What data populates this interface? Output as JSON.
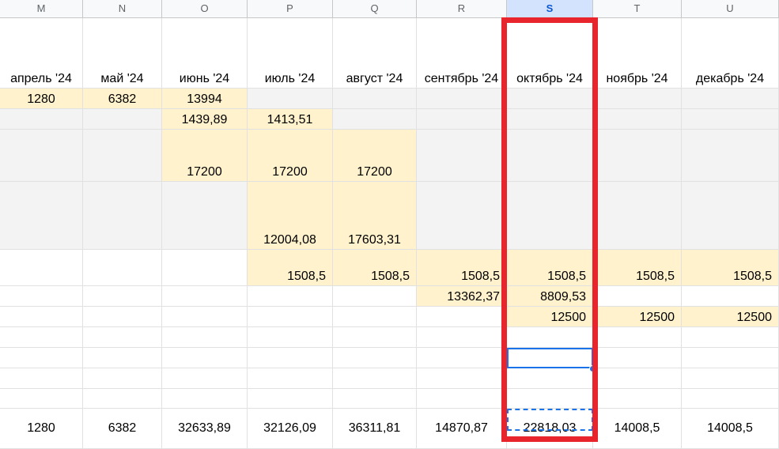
{
  "columns": [
    {
      "letter": "M",
      "month": "апрель '24"
    },
    {
      "letter": "N",
      "month": "май '24"
    },
    {
      "letter": "O",
      "month": "июнь '24"
    },
    {
      "letter": "P",
      "month": "июль '24"
    },
    {
      "letter": "Q",
      "month": "август '24"
    },
    {
      "letter": "R",
      "month": "сентябрь '24"
    },
    {
      "letter": "S",
      "month": "октябрь '24"
    },
    {
      "letter": "T",
      "month": "ноябрь '24"
    },
    {
      "letter": "U",
      "month": "декабрь '24"
    }
  ],
  "active_column": "S",
  "colors": {
    "fill_grey": "#f3f3f3",
    "fill_yellow": "#fff2cc",
    "selection": "#1a73e8",
    "highlight_frame": "#e8242c"
  },
  "rows": [
    {
      "cells": [
        "1280",
        "6382",
        "13994",
        "",
        "",
        "",
        "",
        "",
        ""
      ],
      "fills": [
        "y",
        "y",
        "y",
        "g",
        "g",
        "g",
        "g",
        "g",
        "g"
      ]
    },
    {
      "cells": [
        "",
        "",
        "1439,89",
        "1413,51",
        "",
        "",
        "",
        "",
        ""
      ],
      "fills": [
        "g",
        "g",
        "y",
        "y",
        "g",
        "g",
        "g",
        "g",
        "g"
      ]
    },
    {
      "cells": [
        "",
        "",
        "17200",
        "17200",
        "17200",
        "",
        "",
        "",
        ""
      ],
      "fills": [
        "g",
        "g",
        "y",
        "y",
        "y",
        "g",
        "g",
        "g",
        "g"
      ]
    },
    {
      "cells": [
        "",
        "",
        "",
        "12004,08",
        "17603,31",
        "",
        "",
        "",
        ""
      ],
      "fills": [
        "g",
        "g",
        "g",
        "y",
        "y",
        "g",
        "g",
        "g",
        "g"
      ]
    },
    {
      "cells": [
        "",
        "",
        "",
        "1508,5",
        "1508,5",
        "1508,5",
        "1508,5",
        "1508,5",
        "1508,5"
      ],
      "fills": [
        "w",
        "w",
        "w",
        "y",
        "y",
        "y",
        "y",
        "y",
        "y"
      ]
    },
    {
      "cells": [
        "",
        "",
        "",
        "",
        "",
        "13362,37",
        "8809,53",
        "",
        ""
      ],
      "fills": [
        "w",
        "w",
        "w",
        "w",
        "w",
        "y",
        "y",
        "w",
        "w"
      ]
    },
    {
      "cells": [
        "",
        "",
        "",
        "",
        "",
        "",
        "12500",
        "12500",
        "12500"
      ],
      "fills": [
        "w",
        "w",
        "w",
        "w",
        "w",
        "w",
        "y",
        "y",
        "y"
      ]
    },
    {
      "cells": [
        "",
        "",
        "",
        "",
        "",
        "",
        "",
        "",
        ""
      ],
      "fills": [
        "w",
        "w",
        "w",
        "w",
        "w",
        "w",
        "w",
        "w",
        "w"
      ]
    },
    {
      "cells": [
        "",
        "",
        "",
        "",
        "",
        "",
        "",
        "",
        ""
      ],
      "fills": [
        "w",
        "w",
        "w",
        "w",
        "w",
        "w",
        "w",
        "w",
        "w"
      ]
    },
    {
      "cells": [
        "",
        "",
        "",
        "",
        "",
        "",
        "",
        "",
        ""
      ],
      "fills": [
        "w",
        "w",
        "w",
        "w",
        "w",
        "w",
        "w",
        "w",
        "w"
      ]
    },
    {
      "cells": [
        "1280",
        "6382",
        "32633,89",
        "32126,09",
        "36311,81",
        "14870,87",
        "22818,03",
        "14008,5",
        "14008,5"
      ],
      "fills": [
        "w",
        "w",
        "w",
        "w",
        "w",
        "w",
        "w",
        "w",
        "w"
      ]
    }
  ]
}
